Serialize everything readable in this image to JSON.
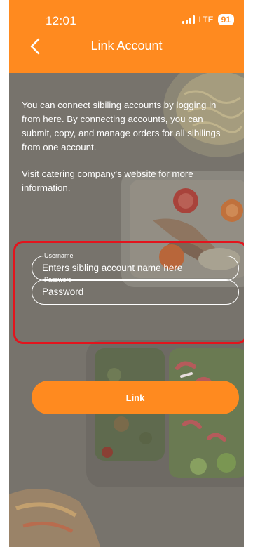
{
  "status_bar": {
    "time": "12:01",
    "network": "LTE",
    "battery": "91"
  },
  "header": {
    "title": "Link Account"
  },
  "intro": {
    "paragraph1": "You can connect sibiling accounts by logging in from here. By connecting accounts, you can submit, copy, and manage orders for all sibilings from one account.",
    "paragraph2": "Visit catering company's website for more information."
  },
  "form": {
    "username": {
      "label": "Username",
      "placeholder": "Enters sibling account name here"
    },
    "password": {
      "label": "Password",
      "placeholder": "Password"
    },
    "link_label": "Link"
  },
  "colors": {
    "brand": "#ff8a1f",
    "highlight": "#e2141d",
    "overlay": "#6f6c66"
  }
}
